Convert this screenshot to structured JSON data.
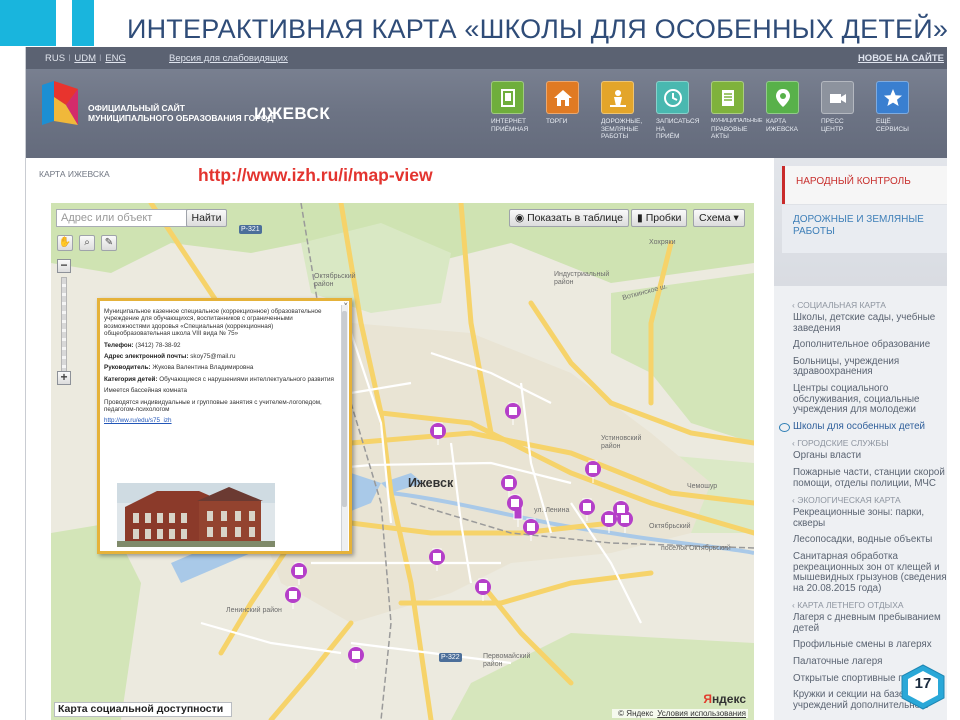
{
  "slide": {
    "title": "ИНТЕРАКТИВНАЯ КАРТА «ШКОЛЫ ДЛЯ ОСОБЕННЫХ ДЕТЕЙ»",
    "page_number": "17",
    "accent_color": "#19b5dd"
  },
  "header": {
    "langs": [
      "RUS",
      "UDM",
      "ENG"
    ],
    "lang_separator": "I",
    "version_link": "Версия для слабовидящих",
    "new_link": "НОВОЕ НА САЙТЕ",
    "site_name_line1": "ОФИЦИАЛЬНЫЙ САЙТ",
    "site_name_line2": "МУНИЦИПАЛЬНОГО ОБРАЗОВАНИЯ ГОРОД",
    "city": "ИЖЕВСК",
    "nav": [
      {
        "l1": "ИНТЕРНЕТ",
        "l2": "ПРИЁМНАЯ",
        "l3": "",
        "color": "#6fae3c",
        "icon": "document-icon"
      },
      {
        "l1": "ТОРГИ",
        "l2": "",
        "l3": "",
        "color": "#e07a23",
        "icon": "house-icon"
      },
      {
        "l1": "ДОРОЖНЫЕ,",
        "l2": "ЗЕМЛЯНЫЕ",
        "l3": "РАБОТЫ",
        "color": "#e3a52a",
        "icon": "roadwork-icon"
      },
      {
        "l1": "ЗАПИСАТЬСЯ",
        "l2": "НА",
        "l3": "ПРИЁМ",
        "color": "#49b8b0",
        "icon": "clock-icon"
      },
      {
        "l1": "МУНИЦИПАЛЬНЫЕ",
        "l2": "ПРАВОВЫЕ",
        "l3": "АКТЫ",
        "color": "#7fb23c",
        "icon": "acts-icon"
      },
      {
        "l1": "КАРТА",
        "l2": "ИЖЕВСКА",
        "l3": "",
        "color": "#58b14a",
        "icon": "map-pin-icon"
      },
      {
        "l1": "ПРЕСС",
        "l2": "ЦЕНТР",
        "l3": "",
        "color": "#8d939e",
        "icon": "camera-icon"
      },
      {
        "l1": "ЕЩЁ",
        "l2": "СЕРВИСЫ",
        "l3": "",
        "color": "#3a7fd0",
        "icon": "star-icon"
      }
    ]
  },
  "breadcrumb": "КАРТА ИЖЕВСКА",
  "url": "http://www.izh.ru/i/map-view",
  "map": {
    "search_placeholder": "Адрес или объект",
    "search_button": "Найти",
    "show_table": "Показать в таблице",
    "traffic": "Пробки",
    "scheme": "Схема",
    "footer": "Карта социальной доступности",
    "copyright": "© Яндекс",
    "terms": "Условия использования",
    "yandex_logo_y": "Я",
    "yandex_logo_rest": "ндекс",
    "places": {
      "city": "Ижевск",
      "oktyabrsky": "Октябрьский\nрайон",
      "industrial": "Индустриальный\nрайон",
      "ustinovsky": "Устиновский\nрайон",
      "leninsky": "Ленинский район",
      "pervomaisky": "Первомайский\nрайон",
      "oktyabrsky_vil": "Октябрьский",
      "chemoshur": "Чемошур",
      "khokhryaki": "Хохряки",
      "posyolok_ok": "посёлок Октябрьский",
      "lenina": "ул. Ленина",
      "votkinskoe": "Воткинское ш.",
      "r321": "Р-321",
      "r322": "Р-322"
    }
  },
  "popup": {
    "org": "Муниципальное казенное специальное (коррекционное) образовательное учреждение для обучающихся, воспитанников с ограниченными возможностями здоровья «Специальная (коррекционная) общеобразовательная школа VIII вида № 75»",
    "phone_label": "Телефон:",
    "phone": "(3412) 78-38-92",
    "email_label": "Адрес электронной почты:",
    "email": "skoy75@mail.ru",
    "head_label": "Руководитель:",
    "head": "Жукова Валентина Владимировна",
    "cat_label": "Категория детей:",
    "cat": "Обучающиеся с нарушениями интеллектуального развития",
    "extra1": "Имеется бассейная комната",
    "extra2": "Проводятся индивидуальные и групповые занятия с учителем-логопедом, педагогом-психологом",
    "link": "http://ww.ru/edu/s75_izh"
  },
  "sidebar": {
    "btn1": "НАРОДНЫЙ КОНТРОЛЬ",
    "btn2": "ДОРОЖНЫЕ И ЗЕМЛЯНЫЕ РАБОТЫ",
    "groups": [
      {
        "title": "СОЦИАЛЬНАЯ КАРТА",
        "items": [
          "Школы, детские сады, учебные заведения",
          "Дополнительное образование",
          "Больницы, учреждения здравоохранения",
          "Центры социального обслуживания, социальные учреждения для молодежи",
          "Школы для особенных детей"
        ]
      },
      {
        "title": "ГОРОДСКИЕ СЛУЖБЫ",
        "items": [
          "Органы власти",
          "Пожарные части, станции скорой помощи, отделы полиции, МЧС"
        ]
      },
      {
        "title": "ЭКОЛОГИЧЕСКАЯ КАРТА",
        "items": [
          "Рекреационные зоны: парки, скверы",
          "Лесопосадки, водные объекты",
          "Санитарная обработка рекреационных зон от клещей и мышевидных грызунов (сведения на 20.08.2015 года)"
        ]
      },
      {
        "title": "КАРТА ЛЕТНЕГО ОТДЫХА",
        "items": [
          "Лагеря с дневным пребыванием детей",
          "Профильные смены в лагерях",
          "Палаточные лагеря",
          "Открытые спортивные площадки",
          "Кружки и секции на базе учреждений дополнительного"
        ]
      }
    ],
    "active_item": "Школы для особенных детей"
  }
}
